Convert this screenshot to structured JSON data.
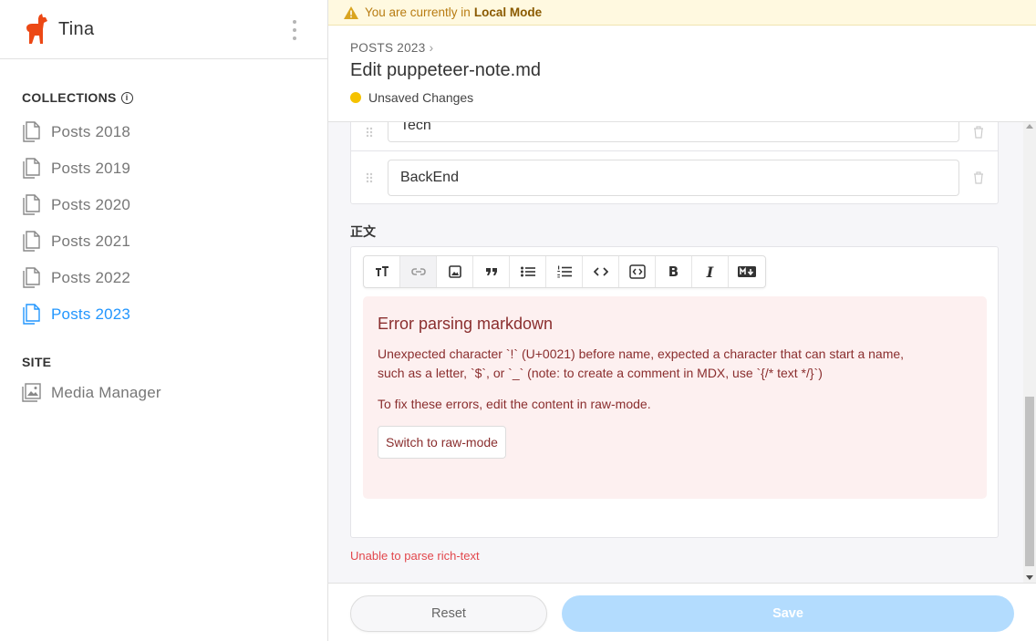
{
  "app": {
    "name": "Tina"
  },
  "sidebar": {
    "collections_title": "COLLECTIONS",
    "collections": [
      {
        "label": "Posts 2018",
        "active": false
      },
      {
        "label": "Posts 2019",
        "active": false
      },
      {
        "label": "Posts 2020",
        "active": false
      },
      {
        "label": "Posts 2021",
        "active": false
      },
      {
        "label": "Posts 2022",
        "active": false
      },
      {
        "label": "Posts 2023",
        "active": true
      }
    ],
    "site_title": "SITE",
    "site_items": [
      {
        "label": "Media Manager"
      }
    ]
  },
  "banner": {
    "prefix": "You are currently in",
    "mode": "Local Mode"
  },
  "header": {
    "breadcrumb": "POSTS 2023",
    "title": "Edit puppeteer-note.md",
    "status": "Unsaved Changes"
  },
  "list_field": {
    "items": [
      "Tech",
      "BackEnd"
    ]
  },
  "body_field": {
    "label": "正文",
    "toolbar": [
      {
        "name": "heading",
        "glyph": "TT"
      },
      {
        "name": "link",
        "glyph": "link",
        "disabled": true
      },
      {
        "name": "image",
        "glyph": "img"
      },
      {
        "name": "quote",
        "glyph": "❞"
      },
      {
        "name": "bulleted-list",
        "glyph": "ul"
      },
      {
        "name": "numbered-list",
        "glyph": "ol"
      },
      {
        "name": "code",
        "glyph": "<>"
      },
      {
        "name": "code-block",
        "glyph": "[<>]"
      },
      {
        "name": "bold",
        "glyph": "B"
      },
      {
        "name": "italic",
        "glyph": "I"
      },
      {
        "name": "markdown",
        "glyph": "M↓"
      }
    ],
    "error": {
      "title": "Error parsing markdown",
      "message": "Unexpected character `!` (U+0021) before name, expected a character that can start a name, such as a letter, `$`, or `_` (note: to create a comment in MDX, use `{/* text */}`)",
      "fix": "To fix these errors, edit the content in raw-mode.",
      "button": "Switch to raw-mode"
    },
    "field_error": "Unable to parse rich-text"
  },
  "footer": {
    "reset": "Reset",
    "save": "Save"
  },
  "colors": {
    "accent": "#2296fe",
    "save_disabled": "#b3dcfe",
    "error_bg": "#fdf0f0",
    "error_text": "#8a2e2e",
    "warning_dot": "#f5c200"
  }
}
